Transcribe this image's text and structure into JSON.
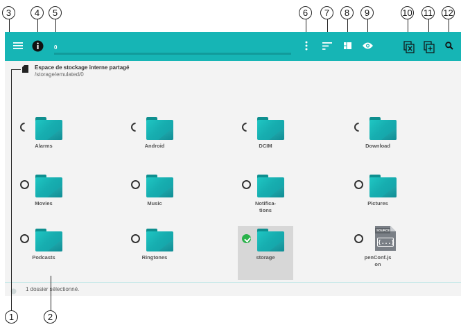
{
  "callouts": [
    "3",
    "4",
    "5",
    "6",
    "7",
    "8",
    "9",
    "10",
    "11",
    "12",
    "1",
    "2"
  ],
  "toolbar": {
    "title": "0",
    "icons": [
      "menu-icon",
      "info-icon",
      "more-vert-icon",
      "sort-icon",
      "view-icon",
      "eye-icon",
      "deselect-icon",
      "select-all-icon",
      "search-icon"
    ],
    "color": "#16b5b5"
  },
  "location": {
    "name": "Espace de stockage interne partagé",
    "path": "/storage/emulated/0"
  },
  "items": [
    {
      "label": "Alarms",
      "type": "folder"
    },
    {
      "label": "Android",
      "type": "folder"
    },
    {
      "label": "DCIM",
      "type": "folder"
    },
    {
      "label": "Download",
      "type": "folder"
    },
    {
      "label": "Movies",
      "type": "folder"
    },
    {
      "label": "Music",
      "type": "folder"
    },
    {
      "label": "Notifica-",
      "label2": "tions",
      "type": "folder"
    },
    {
      "label": "Pictures",
      "type": "folder"
    },
    {
      "label": "Podcasts",
      "type": "folder"
    },
    {
      "label": "Ringtones",
      "type": "folder"
    },
    {
      "label": "storage",
      "type": "folder",
      "selected": true
    },
    {
      "label": "penConf.js",
      "label2": "on",
      "type": "file",
      "badge": "SOURCE",
      "glyph": "{...}"
    }
  ],
  "status": {
    "text": "1 dossier sélectionné."
  }
}
